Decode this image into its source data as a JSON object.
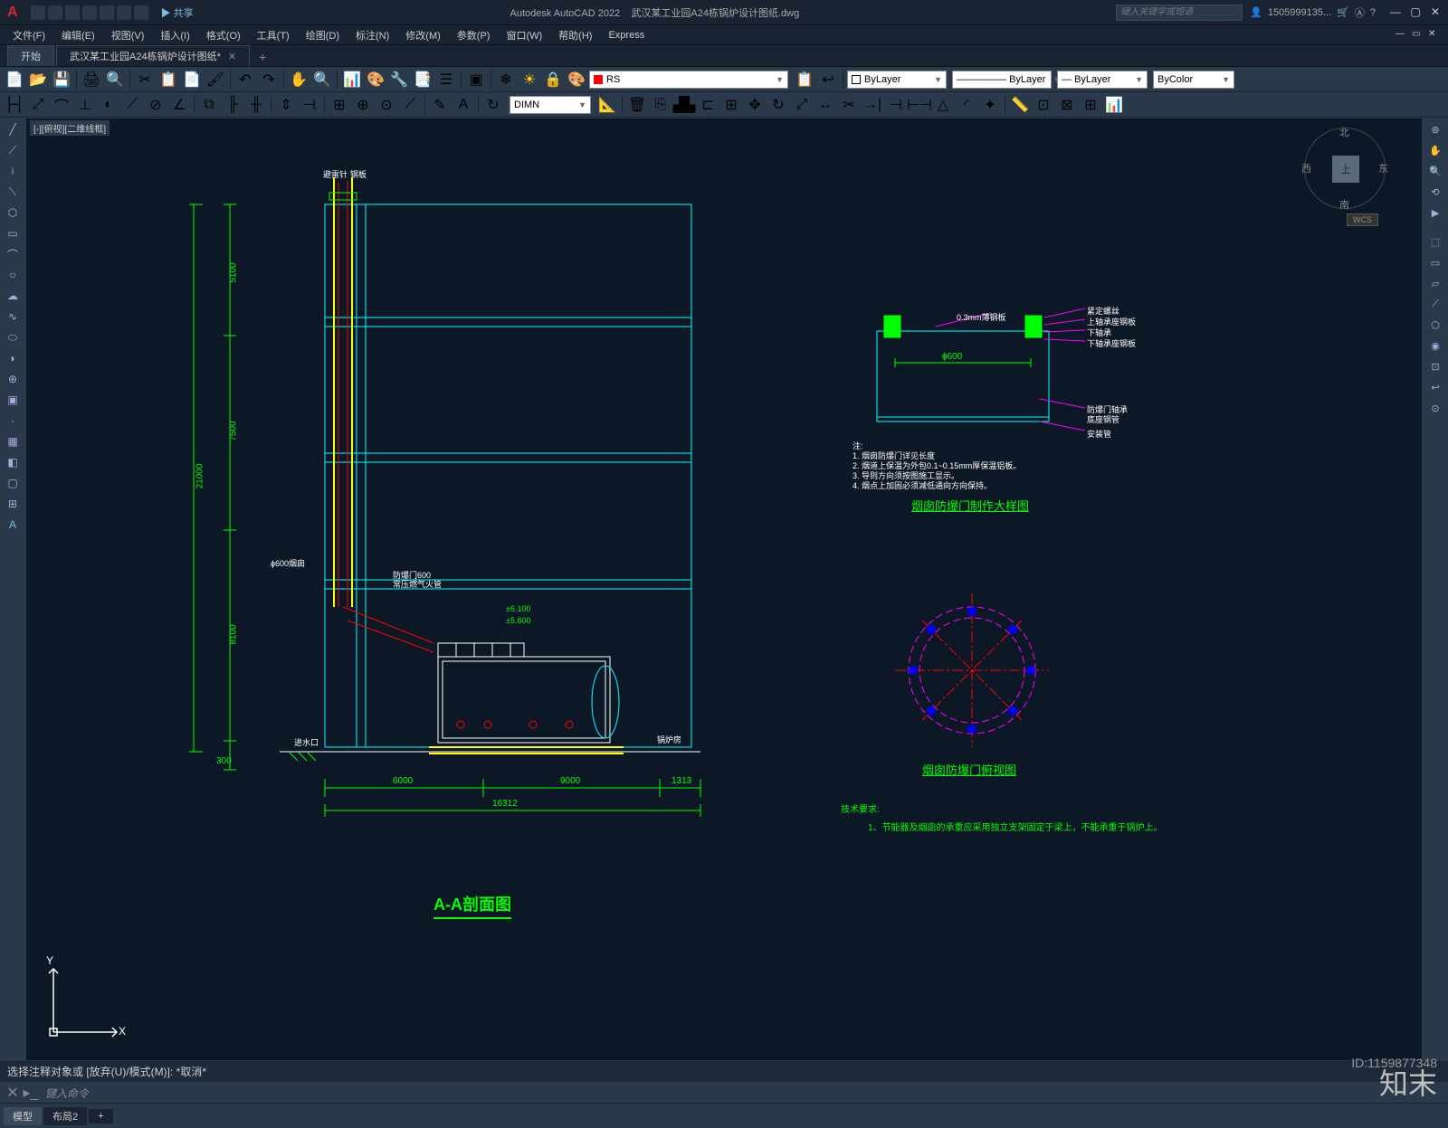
{
  "app": {
    "name": "Autodesk AutoCAD 2022",
    "document": "武汉某工业园A24栋锅炉设计图纸.dwg",
    "share": "共享",
    "search_placeholder": "键入关键字或短语",
    "user": "1505999135...",
    "logo": "A"
  },
  "menus": [
    "文件(F)",
    "编辑(E)",
    "视图(V)",
    "插入(I)",
    "格式(O)",
    "工具(T)",
    "绘图(D)",
    "标注(N)",
    "修改(M)",
    "参数(P)",
    "窗口(W)",
    "帮助(H)",
    "Express"
  ],
  "tabs": {
    "start": "开始",
    "doc": "武汉某工业园A24栋锅炉设计图纸*"
  },
  "layer_controls": {
    "layer": "RS",
    "bylayer1": "ByLayer",
    "bylayer2": "ByLayer",
    "bylayer3": "ByLayer",
    "bycolor": "ByColor",
    "dimn": "DIMN"
  },
  "canvas_label": "[-][俯视][二维线框]",
  "viewcube": {
    "top": "上",
    "n": "北",
    "s": "南",
    "e": "东",
    "w": "西",
    "wcs": "WCS"
  },
  "drawing": {
    "section_title": "A-A剖面图",
    "detail1_title": "烟囱防爆门制作大样图",
    "detail2_title": "烟囱防爆门俯视图",
    "spec_header": "技术要求:",
    "spec_line1": "1、节能器及烟囱的承重应采用独立支架固定于梁上，不能承重于锅炉上。",
    "dims": {
      "h1": "5100",
      "h2": "7500",
      "h3": "8100",
      "h4": "300",
      "total_h": "21000",
      "w1": "6000",
      "w2": "9000",
      "w3": "1313",
      "total_w": "16312",
      "phi600": "ɸ600烟囱",
      "phi600_2": "ɸ600",
      "thickness": "0.3mm薄钢板",
      "elev1": "±6.100",
      "elev2": "±5.600",
      "explosion_door": "防爆门600",
      "explosion_door2": "常压燃气火管"
    },
    "labels": {
      "label1": "避雷针",
      "label2": "钢板",
      "label3": "紧定螺丝",
      "label4": "上轴承座钢板",
      "label5": "下轴承",
      "label6": "下轴承座钢板",
      "label7": "防爆门轴承",
      "label8": "底座钢管",
      "label9": "安装管",
      "notes": "注:",
      "note1": "1. 烟囱防爆门详见长度",
      "note2": "2. 烟道上保温为外包0.1~0.15mm厚保温铝板。",
      "note3": "3. 导则方向须按图施工显示。",
      "note4": "4. 烟点上加固必须减低通向方向保持。",
      "boiler": "锅炉房",
      "inlet": "进水口"
    }
  },
  "ucs": {
    "x": "X",
    "y": "Y"
  },
  "cmdline": {
    "history": "选择注释对象或 [放弃(U)/模式(M)]: *取消*",
    "placeholder": "键入命令"
  },
  "status_tabs": {
    "model": "模型",
    "layout": "布局2"
  },
  "watermark": {
    "brand": "知末",
    "id": "ID:1159877348"
  }
}
